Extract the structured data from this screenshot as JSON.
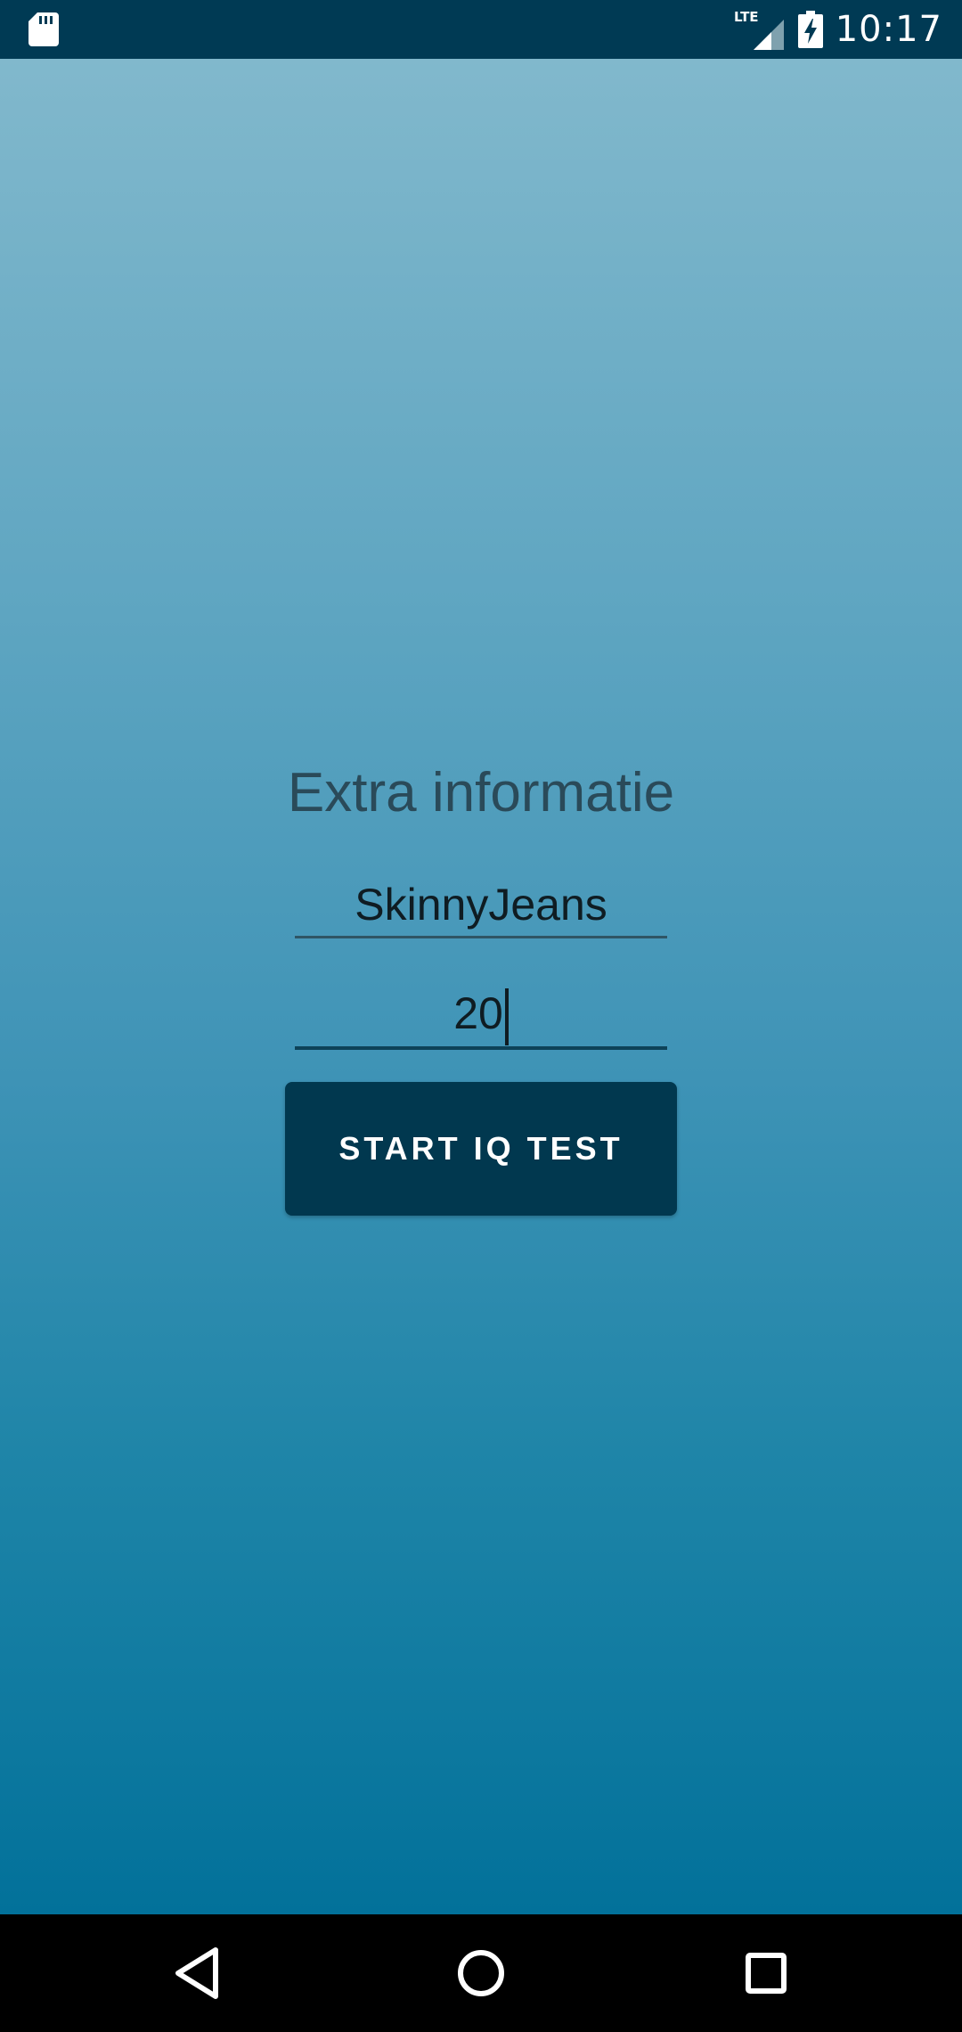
{
  "status_bar": {
    "left_icon": "sd-card-icon",
    "network_label": "LTE",
    "battery_icon": "battery-charging-icon",
    "time": "10:17"
  },
  "form": {
    "title": "Extra informatie",
    "name_value": "SkinnyJeans",
    "age_value": "20",
    "start_button_label": "START IQ TEST"
  },
  "nav_bar": {
    "back_icon": "back-triangle-icon",
    "home_icon": "home-circle-icon",
    "recents_icon": "recents-square-icon"
  },
  "colors": {
    "status_bar_bg": "#003a54",
    "gradient_top": "#81b8cc",
    "gradient_bottom": "#02719a",
    "button_bg": "#01384f",
    "title_text": "#2a4a59"
  }
}
